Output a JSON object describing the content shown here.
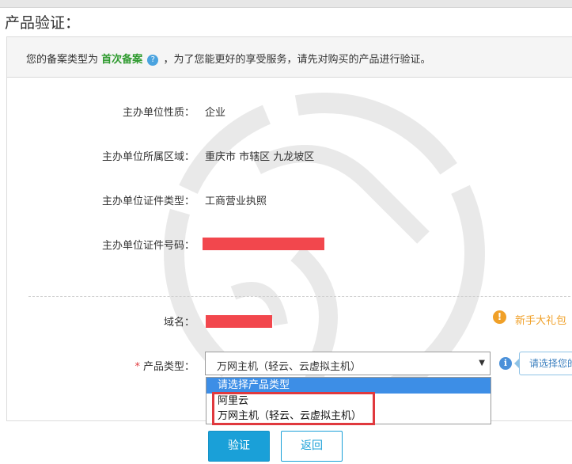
{
  "page": {
    "title": "产品验证："
  },
  "notice": {
    "prefix": "您的备案类型为",
    "type": "首次备案",
    "suffix": "，为了您能更好的享受服务，请先对购买的产品进行验证。",
    "help_glyph": "?"
  },
  "fields": {
    "nature_label": "主办单位性质：",
    "nature_value": "企业",
    "region_label": "主办单位所属区域：",
    "region_value": "重庆市 市辖区 九龙坡区",
    "cert_type_label": "主办单位证件类型：",
    "cert_type_value": "工商营业执照",
    "cert_no_label": "主办单位证件号码：",
    "domain_label": "域名：",
    "product_type_required": "*",
    "product_type_label": "产品类型："
  },
  "product_select": {
    "selected": "万网主机（轻云、云虚拟主机）",
    "caret": "▼",
    "options": [
      "请选择产品类型",
      "阿里云",
      "万网主机（轻云、云虚拟主机）"
    ]
  },
  "hint": {
    "info_glyph": "i",
    "tooltip": "请选择您的"
  },
  "promo": {
    "glyph": "!",
    "text": "新手大礼包"
  },
  "buttons": {
    "verify": "验证",
    "back": "返回"
  },
  "colors": {
    "accent": "#1aa0d8",
    "highlight": "#e0393e",
    "redaction": "#f2474d",
    "type_green": "#2e9a2e",
    "promo_orange": "#f0a028"
  }
}
